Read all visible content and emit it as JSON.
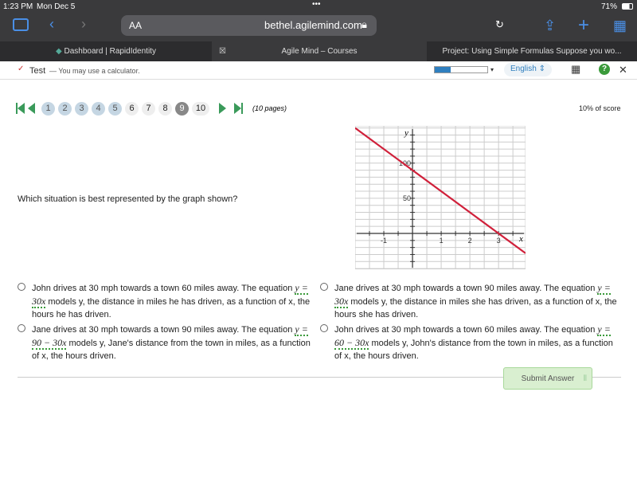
{
  "status": {
    "time": "1:23 PM",
    "date": "Mon Dec 5",
    "battery": "71%"
  },
  "browser": {
    "text_size": "AA",
    "url": "bethel.agilemind.com",
    "tabs": [
      {
        "label": "Dashboard | RapidIdentity"
      },
      {
        "label": "Agile Mind – Courses"
      },
      {
        "label": "Project: Using Simple Formulas Suppose you wo..."
      }
    ]
  },
  "app": {
    "title": "Test",
    "subtitle": "— You may use a calculator.",
    "language": "English",
    "progress": 0.3
  },
  "pager": {
    "pages": [
      "1",
      "2",
      "3",
      "4",
      "5",
      "6",
      "7",
      "8",
      "9",
      "10"
    ],
    "visited": [
      1,
      2,
      3,
      4,
      5
    ],
    "current": 9,
    "count_label": "(10 pages)",
    "score": "10% of score"
  },
  "question": "Which situation is best represented by the graph shown?",
  "options": [
    {
      "pre": "John drives at 30 mph towards a town 60 miles away. The equation ",
      "eq": "y = 30x",
      "post": " models y, the distance in miles he has driven, as a function of x, the hours he has driven."
    },
    {
      "pre": "Jane drives at 30 mph towards a town 90 miles away. The equation ",
      "eq": "y = 30x",
      "post": " models y, the distance in miles she has driven, as a function of x, the hours she has driven."
    },
    {
      "pre": "Jane drives at 30 mph towards a town 90 miles away. The equation ",
      "eq": "y = 90 − 30x",
      "post": " models y, Jane's distance from the town in miles, as a function of x, the hours driven."
    },
    {
      "pre": "John drives at 30 mph towards a town 60 miles away. The equation ",
      "eq": "y = 60 − 30x",
      "post": " models y, John's distance from the town in miles, as a function of x, the hours driven."
    }
  ],
  "submit_label": "Submit Answer",
  "chart_data": {
    "type": "line",
    "xlabel": "x",
    "ylabel": "y",
    "xlim": [
      -2,
      3.94
    ],
    "ylim": [
      -51,
      153
    ],
    "xticks": [
      "-1",
      "1",
      "2",
      "3"
    ],
    "yticks": [
      "50",
      "100"
    ],
    "grid": true,
    "line": {
      "slope": -30,
      "intercept": 90,
      "color": "#d0203a"
    }
  }
}
